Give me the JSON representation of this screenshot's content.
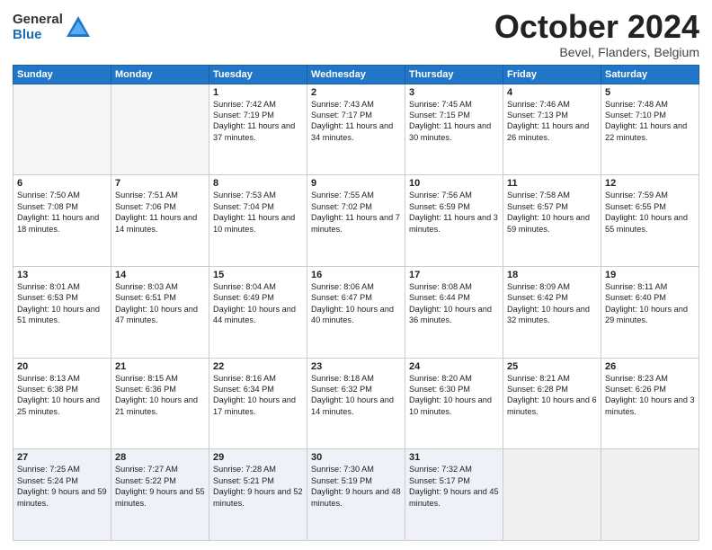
{
  "header": {
    "logo_general": "General",
    "logo_blue": "Blue",
    "month_title": "October 2024",
    "location": "Bevel, Flanders, Belgium"
  },
  "weekdays": [
    "Sunday",
    "Monday",
    "Tuesday",
    "Wednesday",
    "Thursday",
    "Friday",
    "Saturday"
  ],
  "weeks": [
    [
      {
        "num": "",
        "sunrise": "",
        "sunset": "",
        "daylight": "",
        "empty": true
      },
      {
        "num": "",
        "sunrise": "",
        "sunset": "",
        "daylight": "",
        "empty": true
      },
      {
        "num": "1",
        "sunrise": "Sunrise: 7:42 AM",
        "sunset": "Sunset: 7:19 PM",
        "daylight": "Daylight: 11 hours and 37 minutes."
      },
      {
        "num": "2",
        "sunrise": "Sunrise: 7:43 AM",
        "sunset": "Sunset: 7:17 PM",
        "daylight": "Daylight: 11 hours and 34 minutes."
      },
      {
        "num": "3",
        "sunrise": "Sunrise: 7:45 AM",
        "sunset": "Sunset: 7:15 PM",
        "daylight": "Daylight: 11 hours and 30 minutes."
      },
      {
        "num": "4",
        "sunrise": "Sunrise: 7:46 AM",
        "sunset": "Sunset: 7:13 PM",
        "daylight": "Daylight: 11 hours and 26 minutes."
      },
      {
        "num": "5",
        "sunrise": "Sunrise: 7:48 AM",
        "sunset": "Sunset: 7:10 PM",
        "daylight": "Daylight: 11 hours and 22 minutes."
      }
    ],
    [
      {
        "num": "6",
        "sunrise": "Sunrise: 7:50 AM",
        "sunset": "Sunset: 7:08 PM",
        "daylight": "Daylight: 11 hours and 18 minutes."
      },
      {
        "num": "7",
        "sunrise": "Sunrise: 7:51 AM",
        "sunset": "Sunset: 7:06 PM",
        "daylight": "Daylight: 11 hours and 14 minutes."
      },
      {
        "num": "8",
        "sunrise": "Sunrise: 7:53 AM",
        "sunset": "Sunset: 7:04 PM",
        "daylight": "Daylight: 11 hours and 10 minutes."
      },
      {
        "num": "9",
        "sunrise": "Sunrise: 7:55 AM",
        "sunset": "Sunset: 7:02 PM",
        "daylight": "Daylight: 11 hours and 7 minutes."
      },
      {
        "num": "10",
        "sunrise": "Sunrise: 7:56 AM",
        "sunset": "Sunset: 6:59 PM",
        "daylight": "Daylight: 11 hours and 3 minutes."
      },
      {
        "num": "11",
        "sunrise": "Sunrise: 7:58 AM",
        "sunset": "Sunset: 6:57 PM",
        "daylight": "Daylight: 10 hours and 59 minutes."
      },
      {
        "num": "12",
        "sunrise": "Sunrise: 7:59 AM",
        "sunset": "Sunset: 6:55 PM",
        "daylight": "Daylight: 10 hours and 55 minutes."
      }
    ],
    [
      {
        "num": "13",
        "sunrise": "Sunrise: 8:01 AM",
        "sunset": "Sunset: 6:53 PM",
        "daylight": "Daylight: 10 hours and 51 minutes."
      },
      {
        "num": "14",
        "sunrise": "Sunrise: 8:03 AM",
        "sunset": "Sunset: 6:51 PM",
        "daylight": "Daylight: 10 hours and 47 minutes."
      },
      {
        "num": "15",
        "sunrise": "Sunrise: 8:04 AM",
        "sunset": "Sunset: 6:49 PM",
        "daylight": "Daylight: 10 hours and 44 minutes."
      },
      {
        "num": "16",
        "sunrise": "Sunrise: 8:06 AM",
        "sunset": "Sunset: 6:47 PM",
        "daylight": "Daylight: 10 hours and 40 minutes."
      },
      {
        "num": "17",
        "sunrise": "Sunrise: 8:08 AM",
        "sunset": "Sunset: 6:44 PM",
        "daylight": "Daylight: 10 hours and 36 minutes."
      },
      {
        "num": "18",
        "sunrise": "Sunrise: 8:09 AM",
        "sunset": "Sunset: 6:42 PM",
        "daylight": "Daylight: 10 hours and 32 minutes."
      },
      {
        "num": "19",
        "sunrise": "Sunrise: 8:11 AM",
        "sunset": "Sunset: 6:40 PM",
        "daylight": "Daylight: 10 hours and 29 minutes."
      }
    ],
    [
      {
        "num": "20",
        "sunrise": "Sunrise: 8:13 AM",
        "sunset": "Sunset: 6:38 PM",
        "daylight": "Daylight: 10 hours and 25 minutes."
      },
      {
        "num": "21",
        "sunrise": "Sunrise: 8:15 AM",
        "sunset": "Sunset: 6:36 PM",
        "daylight": "Daylight: 10 hours and 21 minutes."
      },
      {
        "num": "22",
        "sunrise": "Sunrise: 8:16 AM",
        "sunset": "Sunset: 6:34 PM",
        "daylight": "Daylight: 10 hours and 17 minutes."
      },
      {
        "num": "23",
        "sunrise": "Sunrise: 8:18 AM",
        "sunset": "Sunset: 6:32 PM",
        "daylight": "Daylight: 10 hours and 14 minutes."
      },
      {
        "num": "24",
        "sunrise": "Sunrise: 8:20 AM",
        "sunset": "Sunset: 6:30 PM",
        "daylight": "Daylight: 10 hours and 10 minutes."
      },
      {
        "num": "25",
        "sunrise": "Sunrise: 8:21 AM",
        "sunset": "Sunset: 6:28 PM",
        "daylight": "Daylight: 10 hours and 6 minutes."
      },
      {
        "num": "26",
        "sunrise": "Sunrise: 8:23 AM",
        "sunset": "Sunset: 6:26 PM",
        "daylight": "Daylight: 10 hours and 3 minutes."
      }
    ],
    [
      {
        "num": "27",
        "sunrise": "Sunrise: 7:25 AM",
        "sunset": "Sunset: 5:24 PM",
        "daylight": "Daylight: 9 hours and 59 minutes."
      },
      {
        "num": "28",
        "sunrise": "Sunrise: 7:27 AM",
        "sunset": "Sunset: 5:22 PM",
        "daylight": "Daylight: 9 hours and 55 minutes."
      },
      {
        "num": "29",
        "sunrise": "Sunrise: 7:28 AM",
        "sunset": "Sunset: 5:21 PM",
        "daylight": "Daylight: 9 hours and 52 minutes."
      },
      {
        "num": "30",
        "sunrise": "Sunrise: 7:30 AM",
        "sunset": "Sunset: 5:19 PM",
        "daylight": "Daylight: 9 hours and 48 minutes."
      },
      {
        "num": "31",
        "sunrise": "Sunrise: 7:32 AM",
        "sunset": "Sunset: 5:17 PM",
        "daylight": "Daylight: 9 hours and 45 minutes."
      },
      {
        "num": "",
        "sunrise": "",
        "sunset": "",
        "daylight": "",
        "empty": true,
        "shaded": true
      },
      {
        "num": "",
        "sunrise": "",
        "sunset": "",
        "daylight": "",
        "empty": true,
        "shaded": true
      }
    ]
  ]
}
